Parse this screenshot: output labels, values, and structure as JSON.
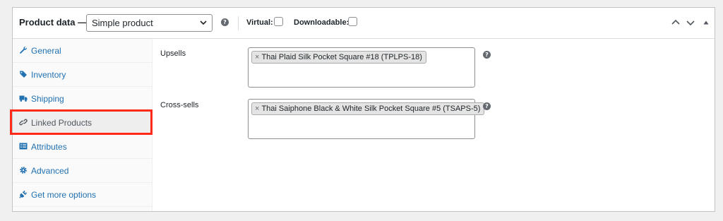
{
  "header": {
    "title": "Product data —",
    "product_type": "Simple product",
    "virtual_label": "Virtual:",
    "downloadable_label": "Downloadable:",
    "virtual_checked": false,
    "downloadable_checked": false,
    "help_icon": "help-icon"
  },
  "sidebar": {
    "items": [
      {
        "label": "General",
        "icon": "wrench-icon"
      },
      {
        "label": "Inventory",
        "icon": "tag-icon"
      },
      {
        "label": "Shipping",
        "icon": "truck-icon"
      },
      {
        "label": "Linked Products",
        "icon": "link-icon",
        "active": true,
        "highlighted": true
      },
      {
        "label": "Attributes",
        "icon": "list-icon"
      },
      {
        "label": "Advanced",
        "icon": "gear-icon"
      },
      {
        "label": "Get more options",
        "icon": "plugin-icon"
      }
    ]
  },
  "main": {
    "upsells": {
      "label": "Upsells",
      "chips": [
        "Thai Plaid Silk Pocket Square #18 (TPLPS-18)"
      ]
    },
    "cross_sells": {
      "label": "Cross-sells",
      "chips": [
        "Thai Saiphone Black & White Silk Pocket Square #5 (TSAPS-5)"
      ]
    },
    "chip_remove_glyph": "×"
  },
  "colors": {
    "accent": "#2271b1",
    "highlight": "#ff2a1a"
  }
}
